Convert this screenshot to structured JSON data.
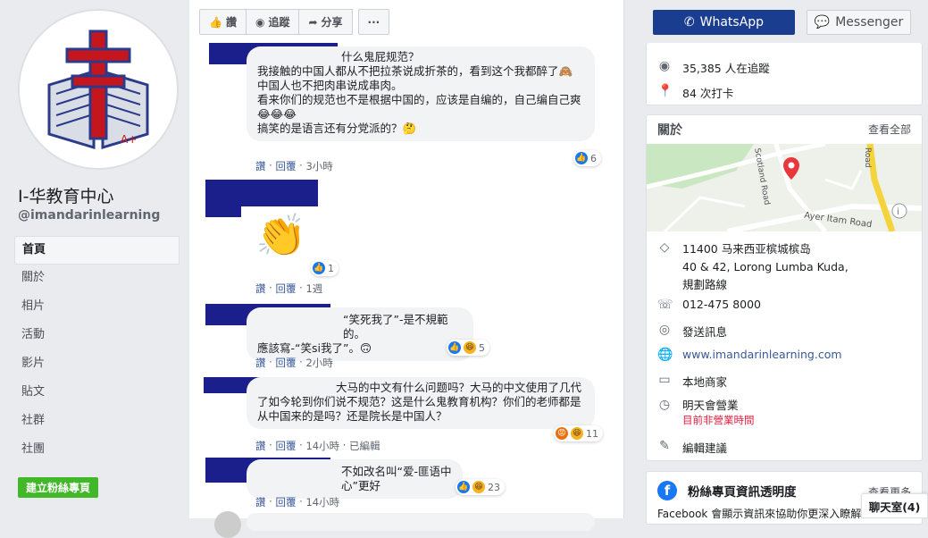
{
  "page": {
    "name": "I-华教育中心",
    "handle": "@imandarinlearning"
  },
  "nav": {
    "items": [
      "首頁",
      "關於",
      "相片",
      "活動",
      "影片",
      "貼文",
      "社群",
      "社團"
    ],
    "create_button": "建立粉絲專頁"
  },
  "toolbar": {
    "like_label": "讚",
    "follow_label": "追蹤",
    "share_label": "分享",
    "more_label": "···"
  },
  "comments": [
    {
      "text_lines": [
        "什么鬼屁规范？",
        "我接触的中国人都从不把拉茶说成折茶的，看到这个我都醉了🙈",
        "中国人也不把肉串说成串肉。",
        "看来你们的规范也不是根据中国的，应该是自编的，自己编自己爽😂😂😂",
        "搞笑的是语言还有分党派的？🤔"
      ],
      "like": "讚",
      "reply": "回覆",
      "time": "3小時",
      "reaction_count": "6"
    },
    {
      "text_lines": [
        "👏"
      ],
      "like": "讚",
      "reply": "回覆",
      "time": "1週",
      "reaction_count": "1"
    },
    {
      "text_lines": [
        "“笑死我了”-是不規範的。",
        "應該寫-“笑si我了”。🙃"
      ],
      "like": "讚",
      "reply": "回覆",
      "time": "2小時",
      "reaction_count": "5"
    },
    {
      "text_lines": [
        "大马的中文有什么问题吗？大马的中文使用了几代了如今轮到你们说不规范？这是什么鬼教育机构？你们的老师都是从中国来的是吗？还是院长是中国人？"
      ],
      "like": "讚",
      "reply": "回覆",
      "time": "14小時",
      "edited": "已編輯",
      "reaction_count": "11"
    },
    {
      "text_lines": [
        "不如改名叫“爱-匪语中心”更好"
      ],
      "like": "讚",
      "reply": "回覆",
      "time": "14小時",
      "reaction_count": "23"
    }
  ],
  "top_buttons": {
    "whatsapp": "WhatsApp",
    "messenger": "Messenger"
  },
  "stats": {
    "followers": "35,385 人在追蹤",
    "checkins": "84 次打卡"
  },
  "about": {
    "title": "關於",
    "see_all": "查看全部",
    "map_labels": [
      "Scotland Road",
      "Ayer Itam Road",
      "Road"
    ],
    "address_line1": "11400 马来西亚槟城槟岛",
    "address_line2": "40 & 42, Lorong Lumba Kuda,",
    "directions": "規劃路線",
    "phone": "012-475 8000",
    "message": "發送訊息",
    "website": "www.imandarinlearning.com",
    "category": "本地商家",
    "hours_label": "明天會營業",
    "hours_status": "目前非營業時間",
    "suggest_edit": "編輯建議"
  },
  "transparency": {
    "title": "粉絲專頁資訊透明度",
    "see_more": "查看更多",
    "text": "Facebook 會顯示資訊來協助你更深入瞭解粉"
  },
  "chat": {
    "label": "聊天室(4)"
  },
  "colors": {
    "accent": "#1877f2",
    "whatsapp_btn": "#1b3d8f",
    "create_btn": "#42b72a",
    "redaction": "#1b1f8c"
  }
}
